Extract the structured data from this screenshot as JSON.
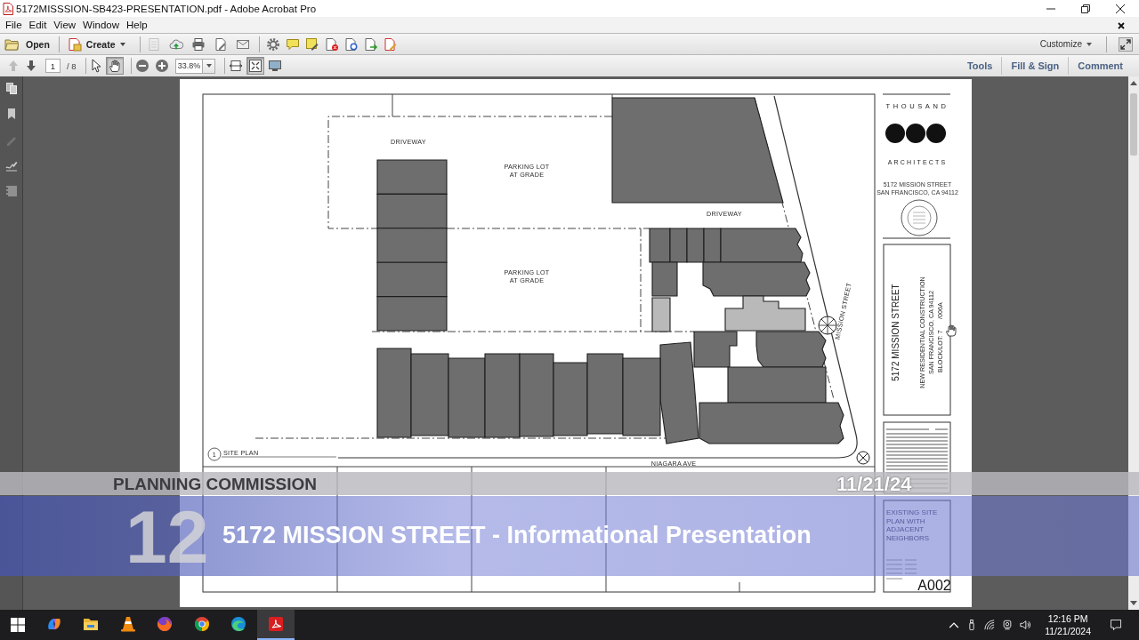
{
  "window": {
    "title": "5172MISSSION-SB423-PRESENTATION.pdf - Adobe Acrobat Pro"
  },
  "menu": [
    "File",
    "Edit",
    "View",
    "Window",
    "Help"
  ],
  "toolbar": {
    "open": "Open",
    "create": "Create",
    "file_actions": [
      {
        "kind": "save",
        "disabled": true
      },
      {
        "kind": "upload",
        "disabled": false
      },
      {
        "kind": "print",
        "disabled": false
      },
      {
        "kind": "edit",
        "disabled": false
      },
      {
        "kind": "email",
        "disabled": false
      }
    ],
    "tool_actions": [
      {
        "kind": "settings",
        "disabled": false
      },
      {
        "kind": "comment",
        "disabled": false
      },
      {
        "kind": "highlight",
        "disabled": false
      },
      {
        "kind": "delete-page",
        "disabled": false
      },
      {
        "kind": "page-properties",
        "disabled": false
      },
      {
        "kind": "export",
        "disabled": false
      },
      {
        "kind": "sign",
        "disabled": false
      }
    ],
    "customize": "Customize"
  },
  "navigation": {
    "buttons": [
      {
        "kind": "previous-page",
        "disabled": true
      },
      {
        "kind": "next-page",
        "disabled": false
      }
    ],
    "page": "1",
    "page_count": "/ 8",
    "tools": [
      {
        "kind": "select",
        "selected": false
      },
      {
        "kind": "hand",
        "selected": true
      }
    ],
    "zoom": "33.8%",
    "views": [
      {
        "kind": "fit-width",
        "selected": false
      },
      {
        "kind": "fit-page",
        "selected": true
      },
      {
        "kind": "read-mode",
        "selected": false
      }
    ],
    "panels": [
      "Tools",
      "Fill & Sign",
      "Comment"
    ]
  },
  "sidebar": [
    {
      "kind": "pages",
      "disabled": false
    },
    {
      "kind": "bookmarks",
      "disabled": false
    },
    {
      "kind": "pen",
      "disabled": true
    },
    {
      "kind": "signature",
      "disabled": false
    },
    {
      "kind": "layers",
      "disabled": false
    }
  ],
  "document": {
    "plan": {
      "labels": [
        {
          "lines": [
            "DRIVEWAY"
          ]
        },
        {
          "lines": [
            "PARKING LOT",
            "AT GRADE"
          ]
        },
        {
          "lines": [
            "DRIVEWAY"
          ]
        },
        {
          "lines": [
            "PARKING LOT",
            "AT GRADE"
          ]
        }
      ],
      "streets": [
        "MISSION STREET",
        "NIAGARA AVE"
      ],
      "view": {
        "number": "1",
        "title": "SITE PLAN"
      }
    },
    "title_block": {
      "firm_top": "THOUSAND",
      "firm_bottom": "ARCHITECTS",
      "address": [
        "5172 MISSION STREET",
        "SAN FRANCISCO, CA 94112"
      ],
      "project_name": "5172 MISSION STREET",
      "project_lines": [
        "NEW RESIDENTIAL CONSTRUCTION",
        "SAN FRANCISCO, CA 94112"
      ],
      "block_lot": [
        "BLOCK/LOT: 7",
        "/006A"
      ],
      "sheet_title": [
        "EXISTING SITE",
        "PLAN WITH",
        "ADJACENT",
        "NEIGHBORS"
      ],
      "sheet_number": "A002"
    }
  },
  "broadcast": {
    "heading": "PLANNING COMMISSION",
    "date": "11/21/24",
    "item": "12",
    "title": "5172 MISSION STREET - Informational Presentation"
  },
  "taskbar": {
    "apps": [
      {
        "kind": "copilot",
        "active": false
      },
      {
        "kind": "folder",
        "active": false
      },
      {
        "kind": "cone",
        "active": false
      },
      {
        "kind": "firefox",
        "active": false
      },
      {
        "kind": "chrome",
        "active": false
      },
      {
        "kind": "edge",
        "active": false
      },
      {
        "kind": "acrobat",
        "active": true
      }
    ],
    "time": "12:16 PM",
    "date": "11/21/2024"
  }
}
